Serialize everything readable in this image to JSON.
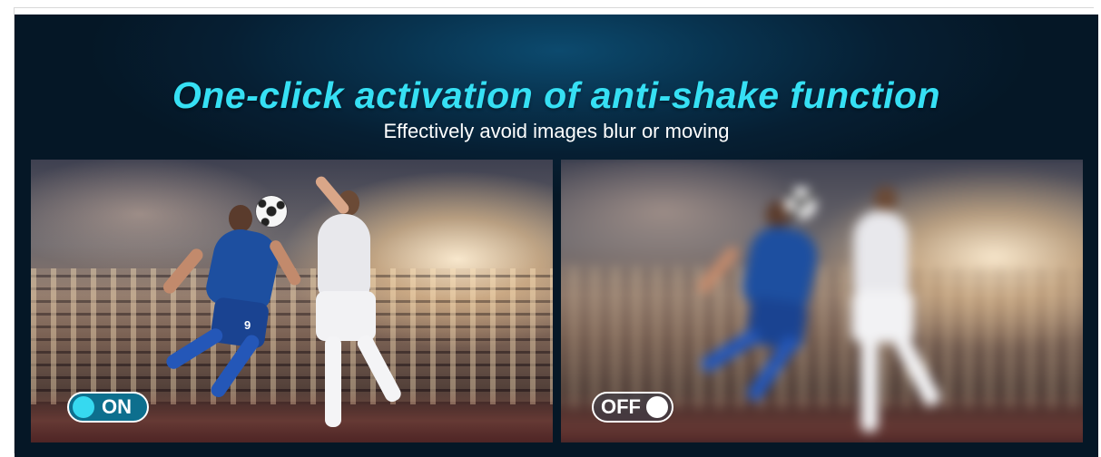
{
  "banner": {
    "headline": "One-click activation of anti-shake function",
    "subhead": "Effectively avoid images blur or moving",
    "colors": {
      "headline": "#36e0f4",
      "background": "#061f33",
      "toggle_on": "#36d9f0"
    }
  },
  "panels": {
    "left": {
      "state": "stabilized",
      "toggle_label": "ON",
      "jersey_number": "9"
    },
    "right": {
      "state": "blurred",
      "toggle_label": "OFF"
    }
  }
}
